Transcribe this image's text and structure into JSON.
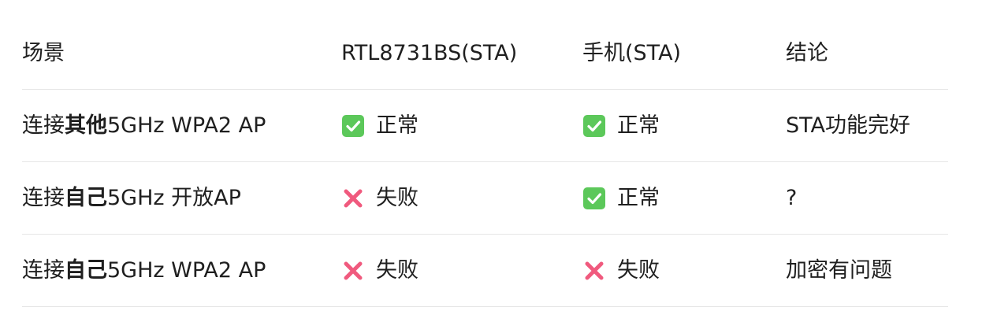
{
  "table": {
    "headers": [
      "场景",
      "RTL8731BS(STA)",
      "手机(STA)",
      "结论"
    ],
    "rows": [
      {
        "scenario": {
          "prefix": "连接",
          "bold": "其他",
          "suffix": "5GHz WPA2 AP"
        },
        "rtl": {
          "icon": "check-mark-button-icon",
          "text": "正常"
        },
        "phone": {
          "icon": "check-mark-button-icon",
          "text": "正常"
        },
        "conclusion": "STA功能完好"
      },
      {
        "scenario": {
          "prefix": "连接",
          "bold": "自己",
          "suffix": "5GHz 开放AP"
        },
        "rtl": {
          "icon": "cross-mark-icon",
          "text": "失败"
        },
        "phone": {
          "icon": "check-mark-button-icon",
          "text": "正常"
        },
        "conclusion": "?"
      },
      {
        "scenario": {
          "prefix": "连接",
          "bold": "自己",
          "suffix": "5GHz WPA2 AP"
        },
        "rtl": {
          "icon": "cross-mark-icon",
          "text": "失败"
        },
        "phone": {
          "icon": "cross-mark-icon",
          "text": "失败"
        },
        "conclusion": "加密有问题"
      }
    ]
  },
  "colors": {
    "check_green": "#5cc85a",
    "cross_red": "#f05a7e",
    "divider": "#e6e6e6",
    "text": "#1f1f1f"
  }
}
